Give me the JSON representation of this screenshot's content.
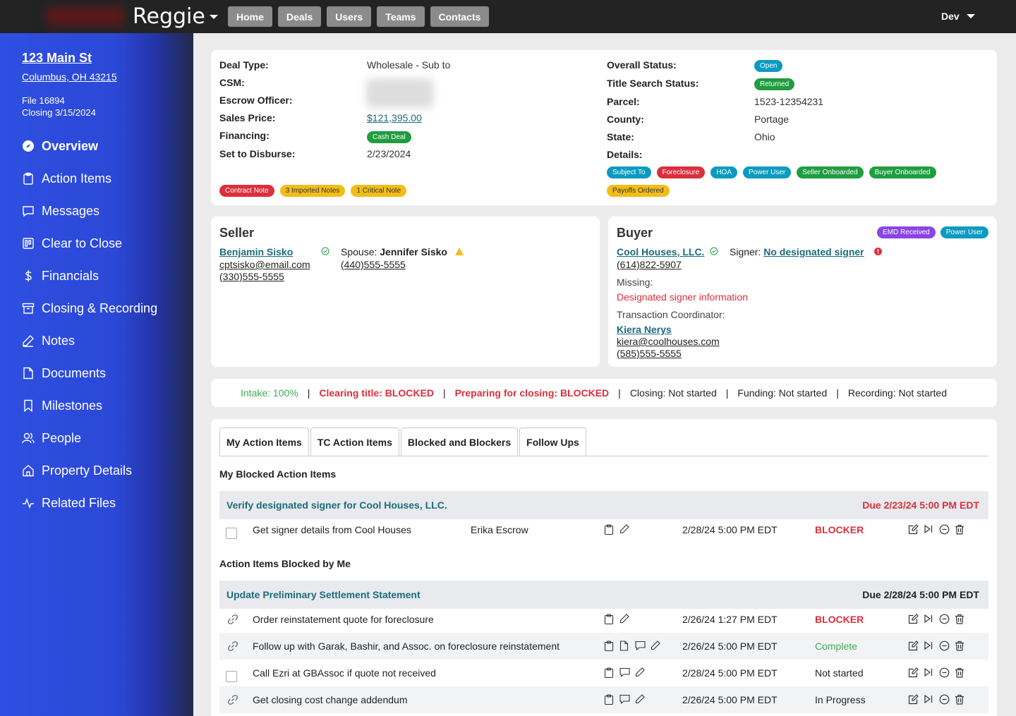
{
  "topbar": {
    "brand": "Reggie",
    "nav": [
      "Home",
      "Deals",
      "Users",
      "Teams",
      "Contacts"
    ],
    "user": "Dev"
  },
  "sidebar": {
    "address_line1": "123 Main St",
    "address_line2": "Columbus, OH 43215",
    "file": "File 16894",
    "closing": "Closing 3/15/2024",
    "items": [
      {
        "label": "Overview",
        "icon": "compass-icon"
      },
      {
        "label": "Action Items",
        "icon": "clipboard-icon"
      },
      {
        "label": "Messages",
        "icon": "chat-icon"
      },
      {
        "label": "Clear to Close",
        "icon": "kanban-icon"
      },
      {
        "label": "Financials",
        "icon": "dollar-icon"
      },
      {
        "label": "Closing & Recording",
        "icon": "archive-icon"
      },
      {
        "label": "Notes",
        "icon": "pencil-icon"
      },
      {
        "label": "Documents",
        "icon": "document-icon"
      },
      {
        "label": "Milestones",
        "icon": "bookmark-icon"
      },
      {
        "label": "People",
        "icon": "people-icon"
      },
      {
        "label": "Property Details",
        "icon": "house-icon"
      },
      {
        "label": "Related Files",
        "icon": "activity-icon"
      }
    ]
  },
  "deal": {
    "deal_type_label": "Deal Type:",
    "deal_type": "Wholesale - Sub to",
    "csm_label": "CSM:",
    "escrow_label": "Escrow Officer:",
    "sales_price_label": "Sales Price:",
    "sales_price": "$121,395.00",
    "financing_label": "Financing:",
    "financing": "Cash Deal",
    "disburse_label": "Set to Disburse:",
    "disburse": "2/23/2024",
    "overall_label": "Overall Status:",
    "overall": "Open",
    "title_label": "Title Search Status:",
    "title": "Returned",
    "parcel_label": "Parcel:",
    "parcel": "1523-12354231",
    "county_label": "County:",
    "county": "Portage",
    "state_label": "State:",
    "state": "Ohio",
    "details_label": "Details:",
    "details": [
      "Subject To",
      "Foreclosure",
      "HOA",
      "Power User",
      "Seller Onboarded",
      "Buyer Onboarded",
      "Payoffs Ordered"
    ],
    "notes": [
      "Contract Note",
      "3 Imported Notes",
      "1 Critical Note"
    ]
  },
  "seller": {
    "title": "Seller",
    "name": "Benjamin Sisko",
    "email": "cptsisko@email.com",
    "phone": "(330)555-5555",
    "spouse_label": "Spouse:",
    "spouse": "Jennifer Sisko",
    "spouse_phone": "(440)555-5555"
  },
  "buyer": {
    "title": "Buyer",
    "badges": [
      "EMD Received",
      "Power User"
    ],
    "name": "Cool Houses, LLC.",
    "phone": "(614)822-5907",
    "signer_label": "Signer:",
    "signer": "No designated signer",
    "missing_label": "Missing:",
    "missing": "Designated signer information",
    "tc_label": "Transaction Coordinator:",
    "tc_name": "Kiera Nerys",
    "tc_email": "kiera@coolhouses.com",
    "tc_phone": "(585)555-5555"
  },
  "status": [
    "Intake: 100%",
    "Clearing title: BLOCKED",
    "Preparing for closing: BLOCKED",
    "Closing: Not started",
    "Funding: Not started",
    "Recording: Not started"
  ],
  "tabs": [
    "My Action Items",
    "TC Action Items",
    "Blocked and Blockers",
    "Follow Ups"
  ],
  "section1": {
    "title": "My Blocked Action Items",
    "group": "Verify designated signer for Cool Houses, LLC.",
    "due": "Due 2/23/24 5:00 PM EDT",
    "rows": [
      {
        "task": "Get signer details from Cool Houses",
        "assignee": "Erika Escrow",
        "date": "2/28/24 5:00 PM EDT",
        "status": "BLOCKER"
      }
    ]
  },
  "section2": {
    "title": "Action Items Blocked by Me",
    "group": "Update Preliminary Settlement Statement",
    "due": "Due 2/28/24 5:00 PM EDT",
    "rows": [
      {
        "task": "Order reinstatement quote for foreclosure",
        "date": "2/26/24 1:27 PM EDT",
        "status": "BLOCKER"
      },
      {
        "task": "Follow up with Garak, Bashir, and Assoc. on foreclosure reinstatement",
        "date": "2/26/24 5:00 PM EDT",
        "status": "Complete"
      },
      {
        "task": "Call Ezri at GBAssoc if quote not received",
        "date": "2/28/24 5:00 PM EDT",
        "status": "Not started"
      },
      {
        "task": "Get closing cost change addendum",
        "date": "2/26/24 5:00 PM EDT",
        "status": "In Progress"
      }
    ]
  }
}
